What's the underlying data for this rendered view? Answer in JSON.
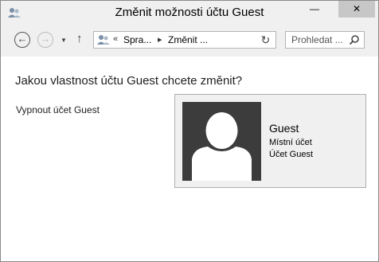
{
  "window": {
    "title": "Změnit možnosti účtu Guest",
    "buttons": {
      "minimize": "—",
      "maximize": "☐",
      "close": "✕"
    }
  },
  "navigation": {
    "back_icon": "arrow-left-icon",
    "forward_icon": "arrow-right-icon",
    "recent_icon": "chevron-down-icon",
    "up_icon": "arrow-up-icon",
    "up_glyph": "↑",
    "address": {
      "prefix": "«",
      "crumbs": [
        "Spra...",
        "Změnit ..."
      ],
      "separator": "▸"
    },
    "search_placeholder": "Prohledat ..."
  },
  "content": {
    "heading": "Jakou vlastnost účtu Guest chcete změnit?",
    "tasks": [
      "Vypnout účet Guest"
    ],
    "account": {
      "name": "Guest",
      "type": "Místní účet",
      "kind": "Účet Guest"
    }
  },
  "colors": {
    "background": "#f0f0f0",
    "content_background": "#ffffff",
    "avatar_background": "#3c3c3c",
    "close_button": "#c7c7c7"
  }
}
